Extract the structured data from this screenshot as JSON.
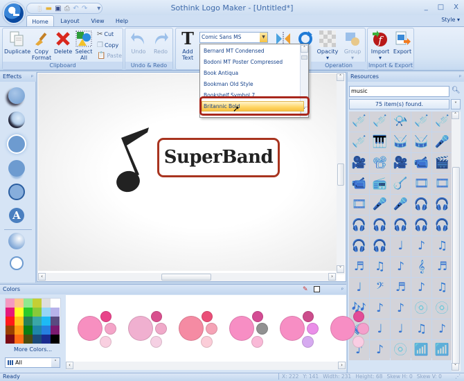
{
  "window": {
    "title": "Sothink Logo Maker - [Untitled*]",
    "controls": {
      "minimize": "_",
      "maximize": "□",
      "close": "X"
    }
  },
  "quick_access": {
    "icons": [
      "new-icon",
      "open-icon",
      "save-icon",
      "print-icon",
      "undo-icon",
      "redo-icon"
    ],
    "customize": "▾"
  },
  "tabs": [
    {
      "label": "Home",
      "active": true
    },
    {
      "label": "Layout",
      "active": false
    },
    {
      "label": "View",
      "active": false
    },
    {
      "label": "Help",
      "active": false
    }
  ],
  "style_menu": "Style",
  "ribbon": {
    "groups": {
      "clipboard": "Clipboard",
      "undo_redo": "Undo & Redo",
      "operation": "Operation",
      "import_export": "Import & Export"
    },
    "buttons": {
      "duplicate": "Duplicate",
      "copy_format_1": "Copy",
      "copy_format_2": "Format",
      "delete": "Delete",
      "select_all_1": "Select",
      "select_all_2": "All",
      "cut": "Cut",
      "copy": "Copy",
      "paste": "Paste",
      "undo": "Undo",
      "redo": "Redo",
      "add_text_1": "Add",
      "add_text_2": "Text",
      "opacity": "Opacity",
      "group": "Group",
      "import": "Import",
      "export": "Export"
    },
    "font_combo": {
      "value": "Comic Sans MS",
      "options": [
        "Bernard MT Condensed",
        "Bodoni MT Poster Compressed",
        "Book Antiqua",
        "Bookman Old Style",
        "Bookshelf Symbol 7",
        "Britannic Bold"
      ],
      "highlighted": "Britannic Bold"
    }
  },
  "effects_panel": {
    "title": "Effects",
    "items": [
      "shadow",
      "inner-shadow",
      "glow",
      "reflection",
      "stroke",
      "text-effect",
      "gradient",
      "outline"
    ]
  },
  "canvas": {
    "logo_text": "SuperBand",
    "logo_text_color": "#222222",
    "frame_color": "#a8341f"
  },
  "resources_panel": {
    "title": "Resources",
    "search_value": "music",
    "result_count": "75 item(s) found.",
    "icons": [
      "🎺",
      "🎺",
      "📯",
      "🎺",
      "🎺",
      "🎺",
      "🎹",
      "🥁",
      "🥁",
      "🎤",
      "🎥",
      "📽",
      "🎥",
      "📹",
      "🎬",
      "📹",
      "📻",
      "🪕",
      "🎞",
      "🎞",
      "🎞",
      "🎤",
      "🎤",
      "🎧",
      "🎧",
      "🎧",
      "🎧",
      "🎧",
      "🎧",
      "🎧",
      "🎧",
      "🎧",
      "♩",
      "♪",
      "♫",
      "♬",
      "♫",
      "♪",
      "𝄞",
      "♬",
      "♩",
      "𝄢",
      "♬",
      "♪",
      "♫",
      "🎶",
      "♪",
      "♪",
      "💿",
      "💿",
      "🪗",
      "♩",
      "♩",
      "♫",
      "♪",
      "♪",
      "♪",
      "💿",
      "📶",
      "📶"
    ]
  },
  "colors_panel": {
    "title": "Colors",
    "swatches": [
      "#f49ac1",
      "#fdc68a",
      "#8fe88f",
      "#c4cf34",
      "#dedede",
      "#ffffff",
      "#e5197b",
      "#ffff22",
      "#2cc92c",
      "#89c93a",
      "#95d5f6",
      "#b7b2ea",
      "#ff1a1a",
      "#ffc61a",
      "#258059",
      "#3aa7a7",
      "#1dbaf5",
      "#5a4a80",
      "#9b3f00",
      "#ff9911",
      "#0b7d14",
      "#1f86a8",
      "#2680e0",
      "#7a1a70",
      "#7a0a14",
      "#ff6a13",
      "#4b4b0f",
      "#1b4a7a",
      "#1a2b8f",
      "#000000"
    ],
    "more_colors": "More Colors...",
    "scheme_filter": "All",
    "palettes": [
      {
        "main": "#f78fc0",
        "top": "#e8448a",
        "mid": "#f4a4c8",
        "bottom": "#f9cfe0"
      },
      {
        "main": "#f0b0d0",
        "top": "#d8508e",
        "mid": "#f0a9c9",
        "bottom": "#f5d0e3"
      },
      {
        "main": "#f58ba3",
        "top": "#ea4f78",
        "mid": "#f5a3b6",
        "bottom": "#fbcdd8"
      },
      {
        "main": "#f78ec4",
        "top": "#d34c93",
        "mid": "#919191",
        "bottom": "#f9b9d7"
      },
      {
        "main": "#f78ec4",
        "top": "#cc4d8c",
        "mid": "#ea8ee8",
        "bottom": "#d6aaf0"
      },
      {
        "main": "#f78ec4",
        "top": "#e24c98",
        "mid": "#f4a0cc",
        "bottom": "#f9cde3"
      }
    ]
  },
  "status_bar": {
    "ready": "Ready",
    "x": "X: 222",
    "y": "Y: 141",
    "width": "Width: 231",
    "height": "Height: 68",
    "skew_h": "Skew H: 0",
    "skew_v": "Skew V: 0"
  }
}
